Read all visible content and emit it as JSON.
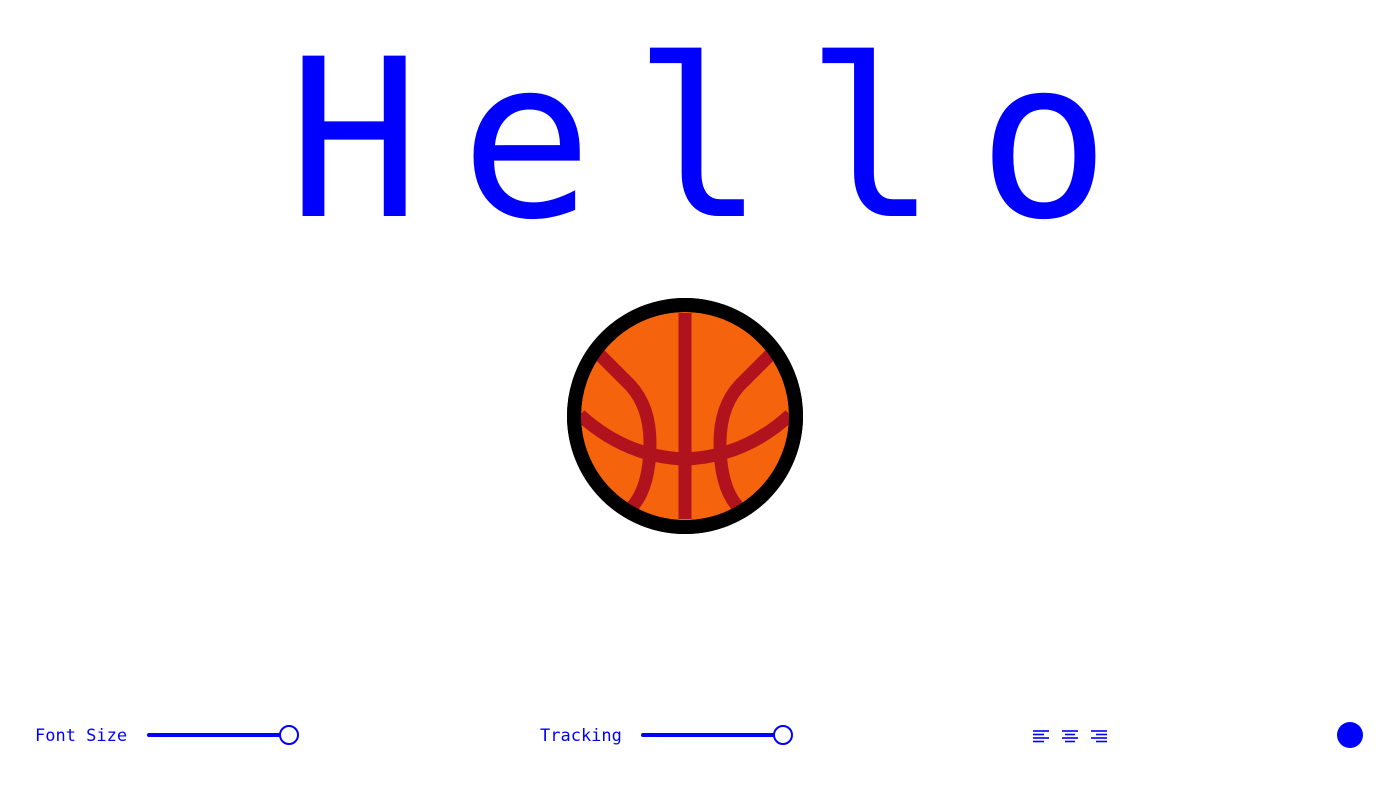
{
  "preview": {
    "text": "Hello",
    "text_color": "#0000ff",
    "emoji_icon": "basketball-icon"
  },
  "controls": {
    "font_size": {
      "label": "Font Size",
      "value_fraction": 0.92
    },
    "tracking": {
      "label": "Tracking",
      "value_fraction": 0.92
    },
    "alignment": {
      "options": [
        "align-left-icon",
        "align-center-icon",
        "align-right-icon"
      ],
      "selected": "center"
    },
    "color_swatch": "#0000ff"
  }
}
